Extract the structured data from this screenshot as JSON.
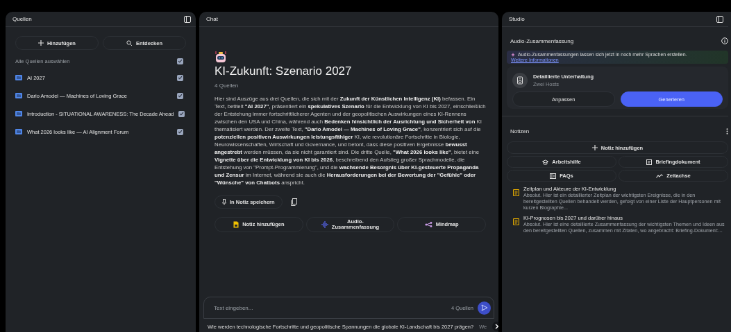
{
  "sources_panel": {
    "title": "Quellen",
    "buttons": [
      {
        "label": "Hinzufügen",
        "kind": "add"
      },
      {
        "label": "Entdecken",
        "kind": "discover"
      }
    ],
    "select_all": {
      "label": "Alle Quellen auswählen",
      "checked": true
    },
    "items": [
      {
        "title": "AI 2027",
        "checked": true
      },
      {
        "title": "Dario Amodei — Machines of Loving Grace",
        "checked": true
      },
      {
        "title": "Introduction - SITUATIONAL AWARENESS: The Decade Ahead",
        "checked": true
      },
      {
        "title": "What 2026 looks like — AI Alignment Forum",
        "checked": true
      }
    ]
  },
  "chat_panel": {
    "title": "Chat",
    "notebook_title": "KI-Zukunft: Szenario 2027",
    "source_count": "4 Quellen",
    "summary": "Hier sind Auszüge aus drei Quellen, die sich mit der **Zukunft der Künstlichen Intelligenz (KI)** befassen. Ein Text, betitelt **\"AI 2027\"**, präsentiert ein **spekulatives Szenario** für die Entwicklung von KI bis 2027, einschließlich der Entstehung immer fortschrittlicherer Agenten und der geopolitischen Auswirkungen eines KI-Rennens zwischen den USA und China, während auch **Bedenken hinsichtlich der Ausrichtung und Sicherheit von** KI thematisiert werden. Der zweite Text, **\"Dario Amodei — Machines of Loving Grace\"**, konzentriert sich auf die **potenziellen positiven Auswirkungen leistungsfähiger** KI, wie revolutionäre Fortschritte in Biologie, Neurowissenschaften, Wirtschaft und Governance, und betont, dass diese positiven Ergebnisse **bewusst angestrebt** werden müssen, da sie nicht garantiert sind. Die dritte Quelle, **\"What 2026 looks like\"**, bietet eine **Vignette über die Entwicklung von KI bis 2026**, beschreibend den Aufstieg großer Sprachmodelle, die Entstehung von \"Prompt-Programmierung\", und die **wachsende Besorgnis über KI-gesteuerte Propaganda und Zensur** im Internet, während sie auch die **Herausforderungen bei der Bewertung der \"Gefühle\" oder \"Wünsche\" von Chatbots** anspricht.",
    "save_button": "In Notiz speichern",
    "actions": [
      {
        "label": "Notiz hinzufügen",
        "kind": "note"
      },
      {
        "label": "Audio-\nZusammenfassung",
        "kind": "audio"
      },
      {
        "label": "Mindmap",
        "kind": "mindmap"
      }
    ],
    "input": {
      "placeholder": "Text eingeben...",
      "source_count": "4 Quellen"
    },
    "suggestions": [
      "Wie werden technologische Fortschritte und geopolitische Spannungen die globale KI-Landschaft bis 2027 prägen?",
      "We"
    ]
  },
  "studio_panel": {
    "title": "Studio",
    "audio": {
      "title": "Audio-Zusammenfassung",
      "banner_text": "Audio-Zusammenfassungen lassen sich jetzt in noch mehr Sprachen erstellen.",
      "banner_link": "Weitere Informationen",
      "format_title": "Detaillierte Unterhaltung",
      "format_subtitle": "Zwei Hosts",
      "buttons": [
        {
          "label": "Anpassen",
          "primary": false
        },
        {
          "label": "Generieren",
          "primary": true
        }
      ]
    },
    "notes": {
      "title": "Notizen",
      "add_button": "Notiz hinzufügen",
      "tools": [
        {
          "label": "Arbeitshilfe",
          "kind": "study"
        },
        {
          "label": "Briefingdokument",
          "kind": "briefing"
        },
        {
          "label": "FAQs",
          "kind": "faq"
        },
        {
          "label": "Zeitachse",
          "kind": "timeline"
        }
      ],
      "items": [
        {
          "title": "Zeitplan und Akteure der KI-Entwicklung",
          "excerpt": "Absolut. Hier ist ein detaillierter Zeitplan der wichtigsten Ereignisse, die in den bereitgestellten Quellen behandelt werden, gefolgt von einer Liste der Hauptpersonen mit kurzen Biographie..."
        },
        {
          "title": "KI-Prognosen bis 2027 und darüber hinaus",
          "excerpt": "Absolut. Hier ist eine detaillierte Zusammenfassung der wichtigsten Themen und Ideen aus den bereitgestellten Quellen, zusammen mit Zitaten, wo angebracht: Briefing-Dokument:..."
        }
      ]
    }
  }
}
